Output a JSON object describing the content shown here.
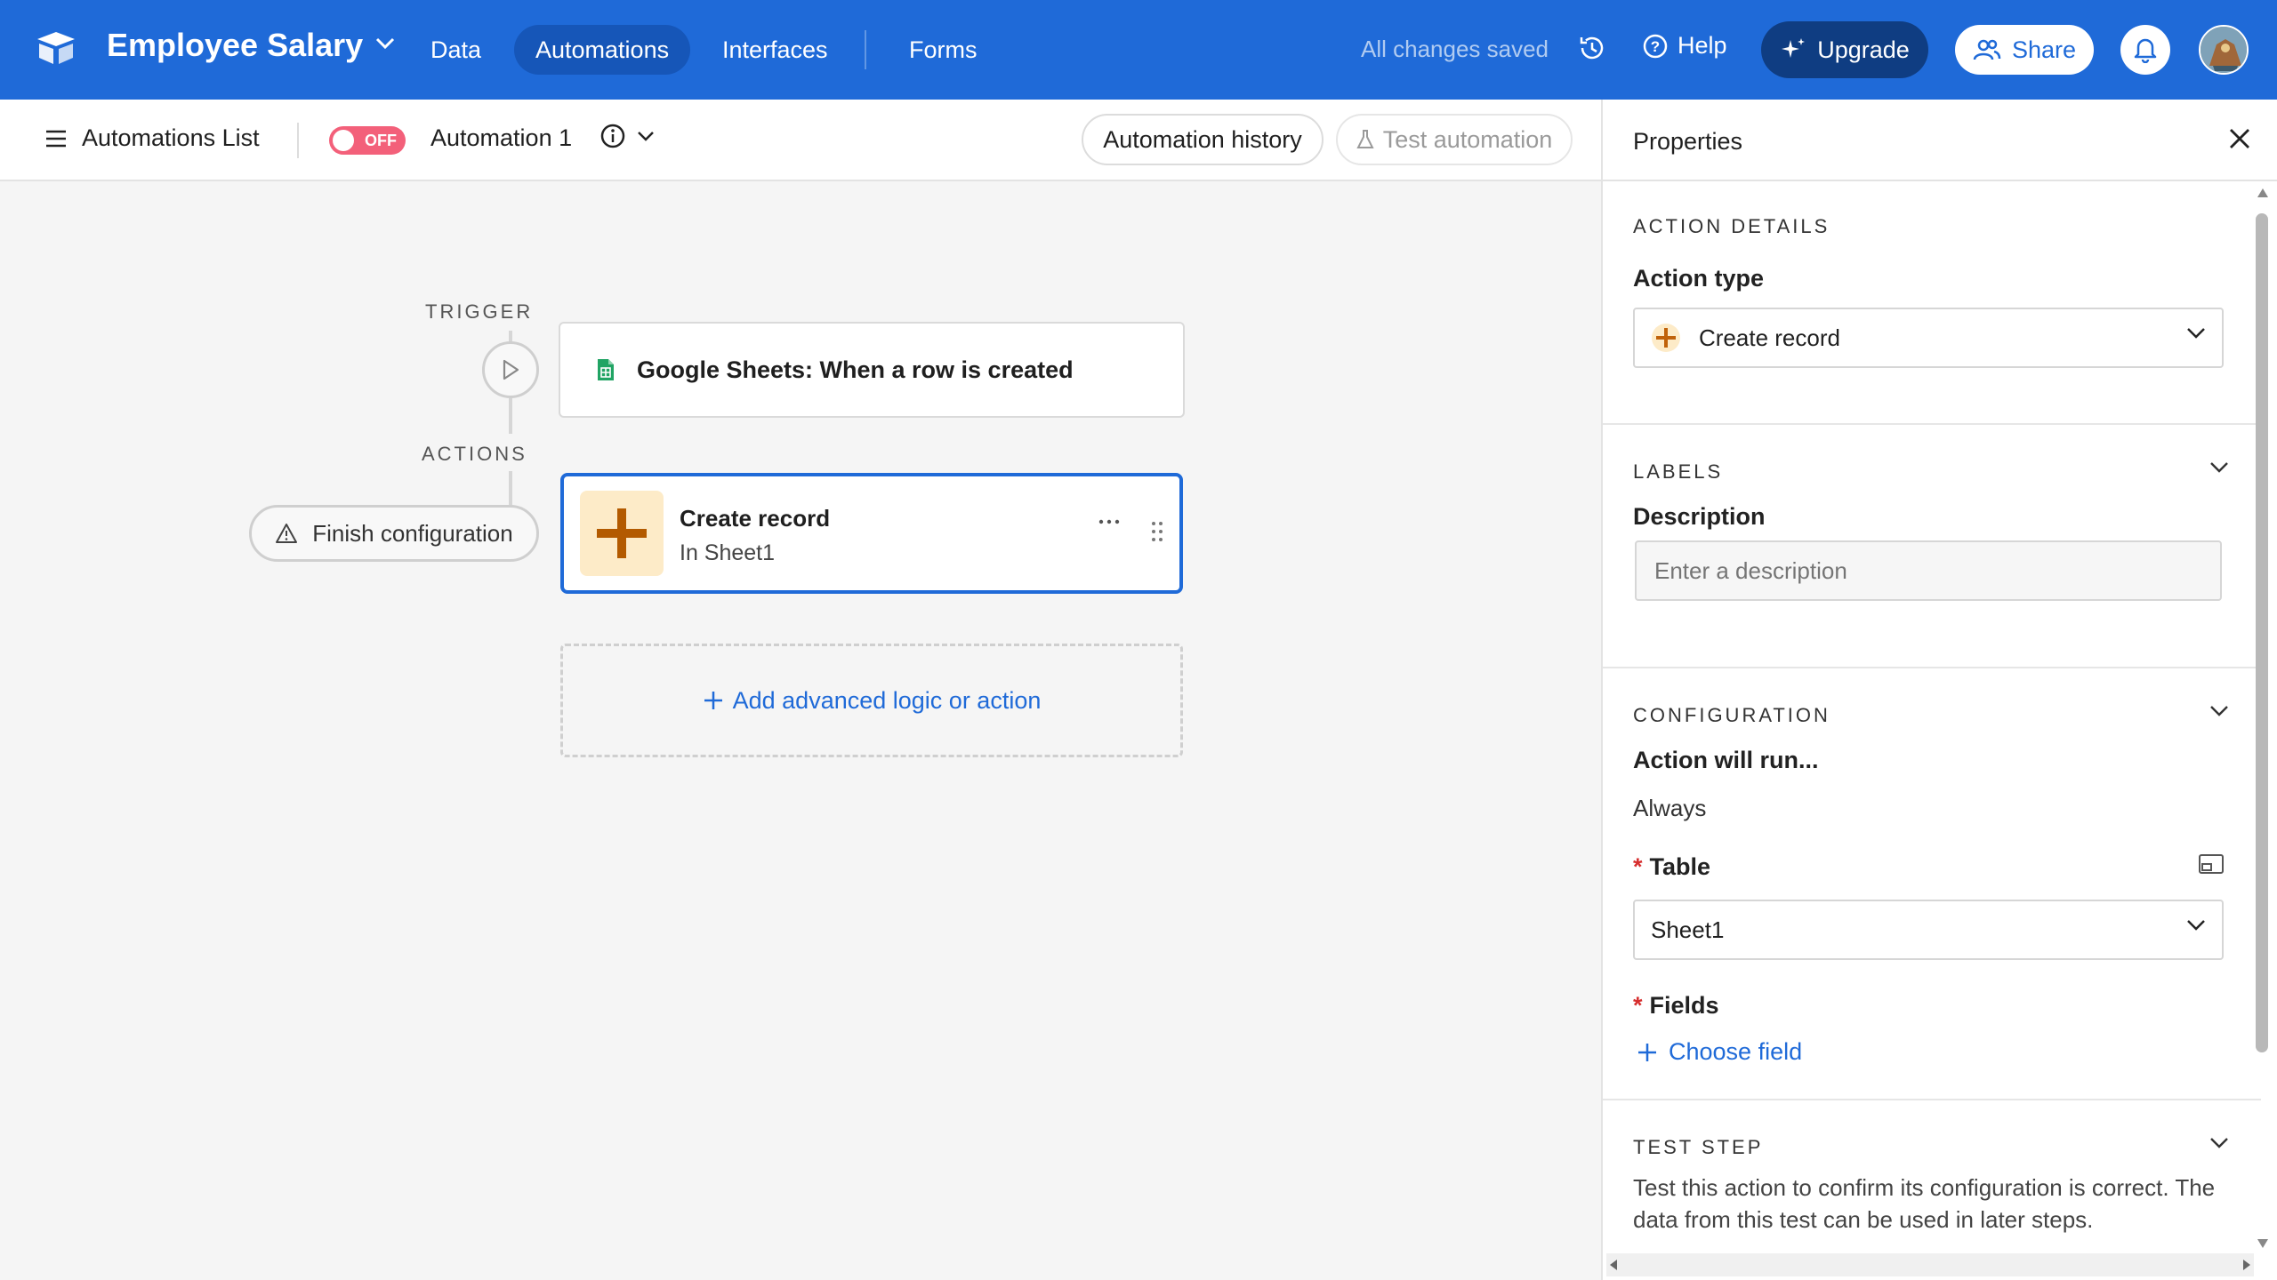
{
  "topbar": {
    "base_name": "Employee Salary",
    "nav": [
      {
        "label": "Data"
      },
      {
        "label": "Automations"
      },
      {
        "label": "Interfaces"
      },
      {
        "label": "Forms"
      }
    ],
    "saved_status": "All changes saved",
    "help_label": "Help",
    "upgrade_label": "Upgrade",
    "share_label": "Share",
    "accent_color": "#1f6ad8"
  },
  "toolbar": {
    "automations_list_label": "Automations List",
    "toggle_state": "OFF",
    "automation_name": "Automation 1",
    "history_label": "Automation history",
    "test_label": "Test automation"
  },
  "canvas": {
    "trigger_label": "TRIGGER",
    "actions_label": "ACTIONS",
    "trigger_title": "Google Sheets: When a row is created",
    "action_title": "Create record",
    "action_subtitle": "In Sheet1",
    "finish_label": "Finish configuration",
    "add_logic_label": "Add advanced logic or action"
  },
  "panel": {
    "title": "Properties",
    "action_details_heading": "ACTION DETAILS",
    "action_type_label": "Action type",
    "action_type_value": "Create record",
    "labels_heading": "LABELS",
    "description_label": "Description",
    "description_placeholder": "Enter a description",
    "configuration_heading": "CONFIGURATION",
    "action_will_run_label": "Action will run...",
    "action_will_run_value": "Always",
    "table_label": "Table",
    "table_value": "Sheet1",
    "fields_label": "Fields",
    "choose_field_label": "Choose field",
    "test_step_heading": "TEST STEP",
    "test_step_text": "Test this action to confirm its configuration is correct. The data from this test can be used in later steps."
  }
}
